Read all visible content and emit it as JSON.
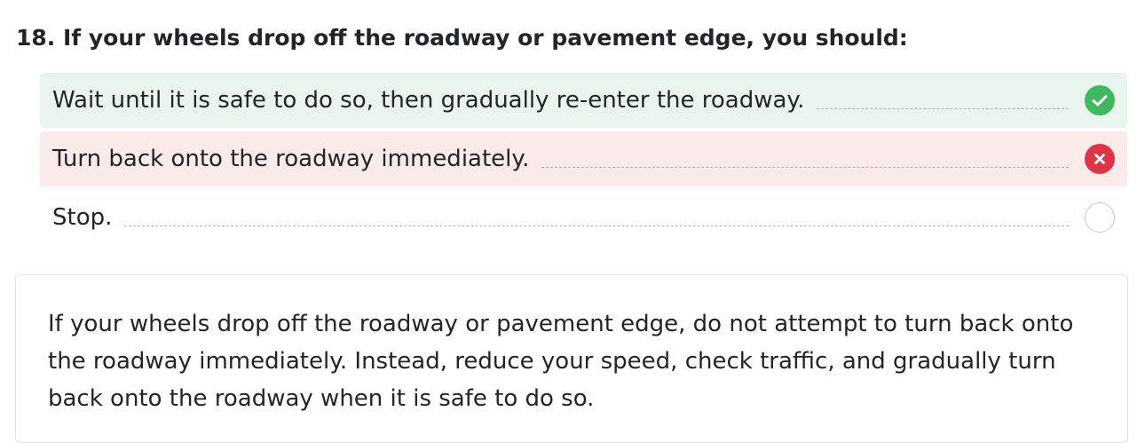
{
  "question": {
    "text": "18. If your wheels drop off the roadway or pavement edge, you should:"
  },
  "answers": [
    {
      "text": "Wait until it is safe to do so, then gradually re-enter the roadway.",
      "state": "correct",
      "icon": "check-icon"
    },
    {
      "text": "Turn back onto the roadway immediately.",
      "state": "wrong",
      "icon": "x-icon"
    },
    {
      "text": "Stop.",
      "state": "neutral",
      "icon": "empty-circle-icon"
    }
  ],
  "explanation": {
    "text": "If your wheels drop off the roadway or pavement edge, do not attempt to turn back onto the roadway immediately. Instead, reduce your speed, check traffic, and gradually turn back onto the roadway when it is safe to do so."
  },
  "colors": {
    "correct_bg": "#e9f5ec",
    "wrong_bg": "#fbeaea",
    "correct_icon": "#3fb85f",
    "wrong_icon": "#dc3545"
  }
}
